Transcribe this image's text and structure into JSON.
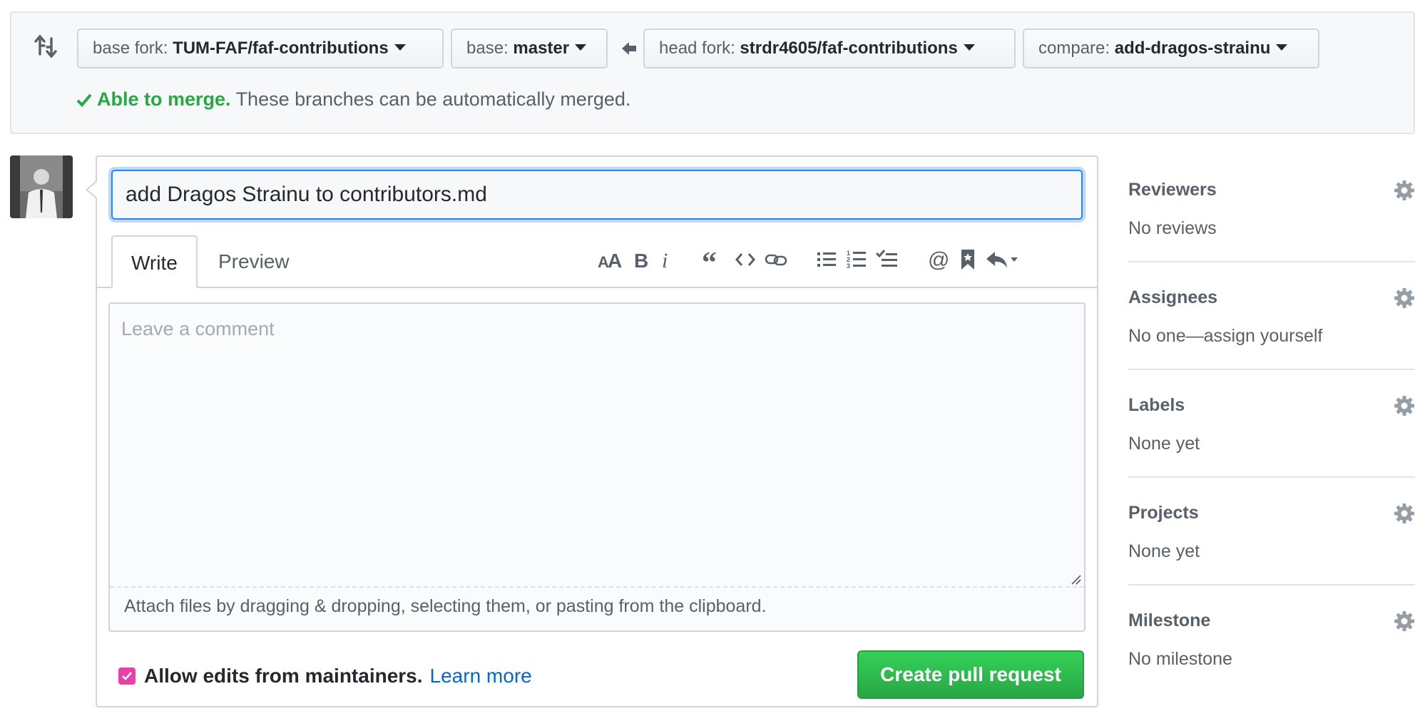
{
  "compare": {
    "base_fork_prefix": "base fork:",
    "base_fork_value": "TUM-FAF/faf-contributions",
    "base_prefix": "base:",
    "base_value": "master",
    "head_fork_prefix": "head fork:",
    "head_fork_value": "strdr4605/faf-contributions",
    "compare_prefix": "compare:",
    "compare_value": "add-dragos-strainu",
    "merge_ok": "Able to merge.",
    "merge_text": "These branches can be automatically merged."
  },
  "form": {
    "title_value": "add Dragos Strainu to contributors.md",
    "tab_write": "Write",
    "tab_preview": "Preview",
    "comment_placeholder": "Leave a comment",
    "attach_hint": "Attach files by dragging & dropping, selecting them, or pasting from the clipboard.",
    "allow_edits_label": "Allow edits from maintainers.",
    "learn_more": "Learn more",
    "allow_edits_checked": true,
    "submit_label": "Create pull request"
  },
  "toolbar_icons": [
    "text-size-icon",
    "bold-icon",
    "italic-icon",
    "quote-icon",
    "code-icon",
    "link-icon",
    "unordered-list-icon",
    "ordered-list-icon",
    "task-list-icon",
    "mention-icon",
    "reference-icon",
    "reply-icon"
  ],
  "sidebar": {
    "reviewers_title": "Reviewers",
    "reviewers_value": "No reviews",
    "assignees_title": "Assignees",
    "assignees_value": "No one—assign yourself",
    "labels_title": "Labels",
    "labels_value": "None yet",
    "projects_title": "Projects",
    "projects_value": "None yet",
    "milestone_title": "Milestone",
    "milestone_value": "No milestone"
  },
  "colors": {
    "success": "#28a745",
    "link": "#0366d6",
    "focus": "#2188ff",
    "checkbox": "#e83fa8"
  }
}
